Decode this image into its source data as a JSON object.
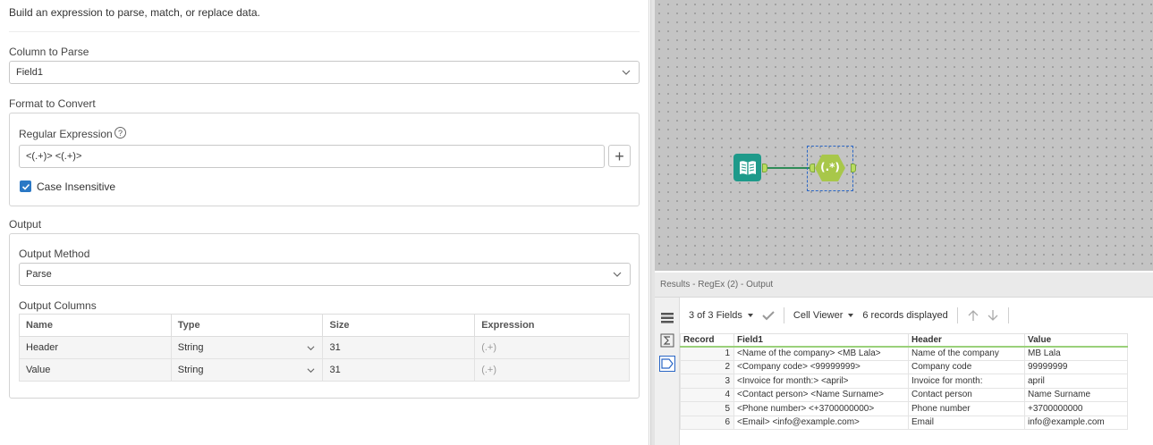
{
  "config": {
    "description": "Build an expression to parse, match, or replace data.",
    "column_to_parse": {
      "label": "Column to Parse",
      "value": "Field1"
    },
    "format_to_convert": {
      "label": "Format to Convert",
      "regex_label": "Regular Expression",
      "help": "?",
      "regex_value": "<(.+)> <(.+)>",
      "add_button": "+",
      "case_insensitive": {
        "label": "Case Insensitive",
        "checked": true
      }
    },
    "output": {
      "label": "Output",
      "method_label": "Output Method",
      "method_value": "Parse",
      "columns_label": "Output Columns",
      "headers": [
        "Name",
        "Type",
        "Size",
        "Expression"
      ],
      "rows": [
        {
          "name": "Header",
          "type": "String",
          "size": "31",
          "expression": "(.+)"
        },
        {
          "name": "Value",
          "type": "String",
          "size": "31",
          "expression": "(.+)"
        }
      ]
    }
  },
  "canvas": {
    "regex_tool_label": "(.*)",
    "input_tool": "book-icon"
  },
  "results": {
    "title": "Results - RegEx (2) - Output",
    "fields_selector": "3 of 3 Fields",
    "cell_viewer": "Cell Viewer",
    "records_displayed": "6 records displayed",
    "headers": [
      "Record",
      "Field1",
      "Header",
      "Value"
    ],
    "rows": [
      {
        "record": "1",
        "field1": "<Name of the company> <MB Lala>",
        "header": "Name of the company",
        "value": "MB Lala"
      },
      {
        "record": "2",
        "field1": "<Company code> <99999999>",
        "header": "Company code",
        "value": "99999999"
      },
      {
        "record": "3",
        "field1": "<Invoice for month:> <april>",
        "header": "Invoice for month:",
        "value": "april"
      },
      {
        "record": "4",
        "field1": "<Contact person> <Name Surname>",
        "header": "Contact person",
        "value": "Name Surname"
      },
      {
        "record": "5",
        "field1": "<Phone number> <+3700000000>",
        "header": "Phone number",
        "value": "+3700000000"
      },
      {
        "record": "6",
        "field1": "<Email> <info@example.com>",
        "header": "Email",
        "value": "info@example.com"
      }
    ]
  },
  "colors": {
    "accent": "#2a78c5",
    "tool_teal": "#1e9a8a",
    "regex_green": "#a8c74a"
  }
}
